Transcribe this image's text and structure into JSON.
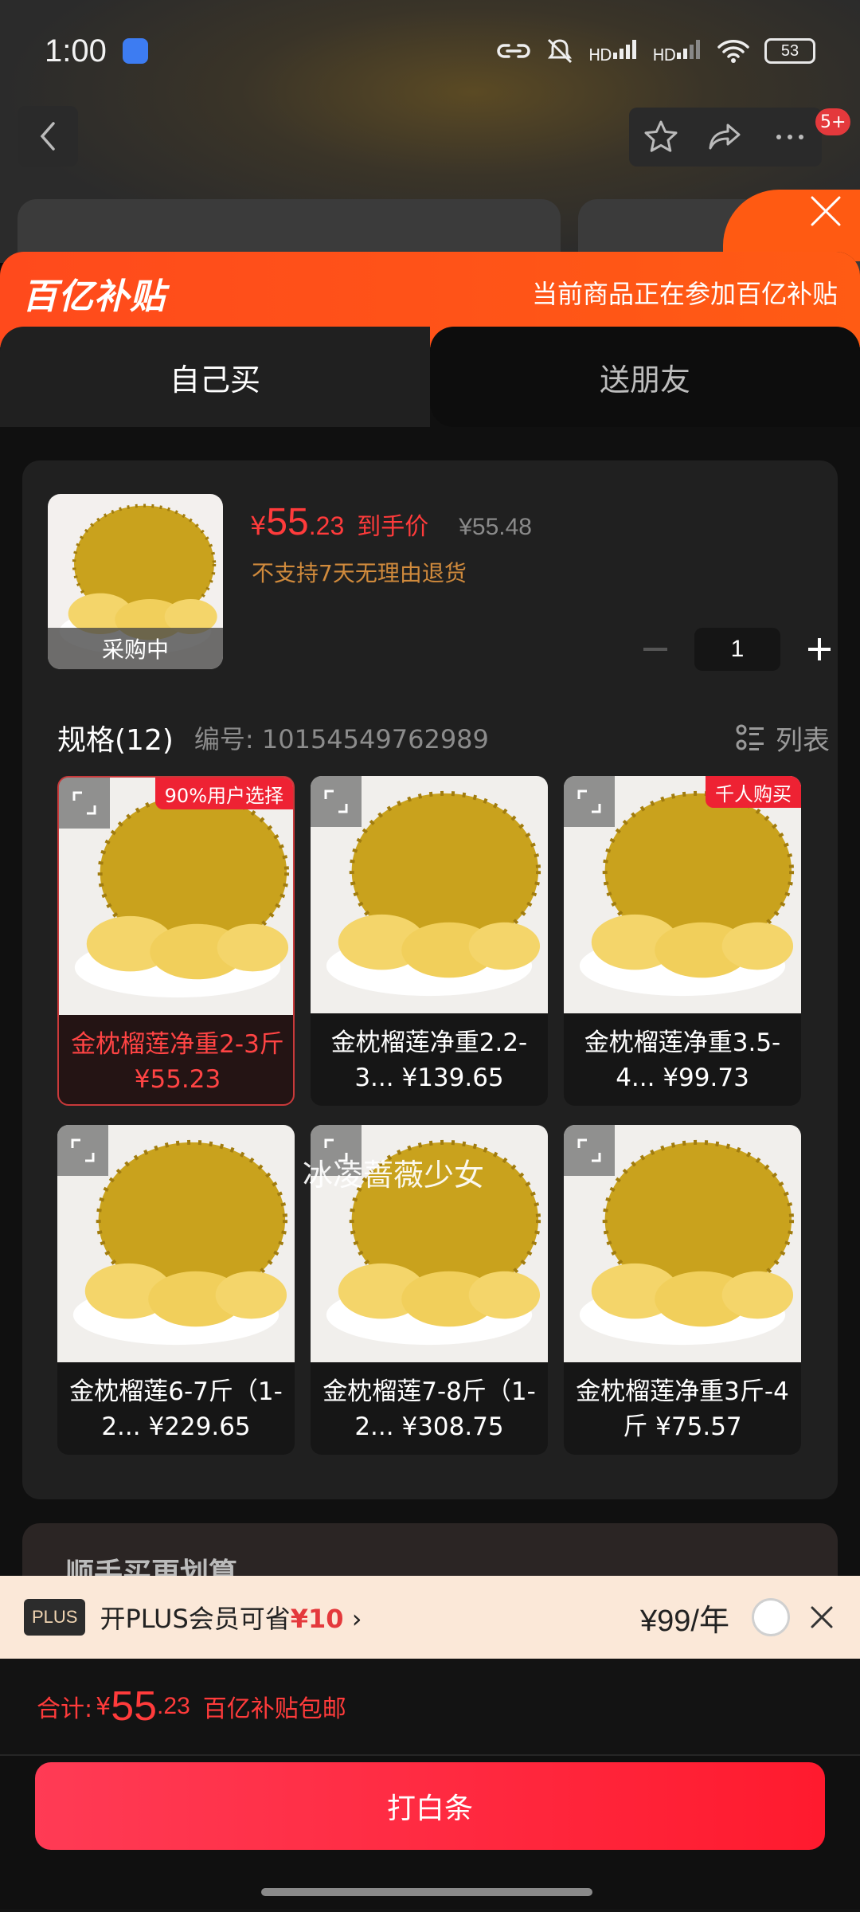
{
  "status": {
    "time": "1:00",
    "battery": "53",
    "signal_1": "HD",
    "signal_2": "HD"
  },
  "header": {
    "notification_badge": "5+"
  },
  "subsidy": {
    "logo": "百亿补贴",
    "text": "当前商品正在参加百亿补贴"
  },
  "tabs": [
    "自己买",
    "送朋友"
  ],
  "product": {
    "thumb_label": "采购中",
    "price_yen": "¥",
    "price_int": "55",
    "price_dec": ".23",
    "price_tag": "到手价",
    "original_price": "¥55.48",
    "return_policy": "不支持7天无理由退货",
    "quantity": "1"
  },
  "spec": {
    "title": "规格(12)",
    "code": "编号: 10154549762989",
    "list_label": "列表"
  },
  "variants": [
    {
      "name": "金枕榴莲净重2-3斤 ¥55.23",
      "tag": "90%用户选择"
    },
    {
      "name": "金枕榴莲净重2.2-3... ¥139.65",
      "tag": ""
    },
    {
      "name": "金枕榴莲净重3.5-4... ¥99.73",
      "tag": "千人购买"
    },
    {
      "name": "金枕榴莲6-7斤（1-2... ¥229.65",
      "tag": ""
    },
    {
      "name": "金枕榴莲7-8斤（1-2... ¥308.75",
      "tag": ""
    },
    {
      "name": "金枕榴莲净重3斤-4斤 ¥75.57",
      "tag": ""
    }
  ],
  "watermark": "冰凌蔷薇少女",
  "addon": {
    "title": "顺手买更划算"
  },
  "plus": {
    "badge": "PLUS",
    "text": "开PLUS会员可省",
    "saving": "¥10",
    "price": "¥99/年"
  },
  "total": {
    "label": "合计:",
    "yen": "¥",
    "int": "55",
    "dec": ".23",
    "note": "百亿补贴包邮"
  },
  "pay_button": "打白条",
  "colors": {
    "accent": "#ff3b3b",
    "subsidy": "#ff4a1c",
    "pay": "#ff1a2e"
  }
}
